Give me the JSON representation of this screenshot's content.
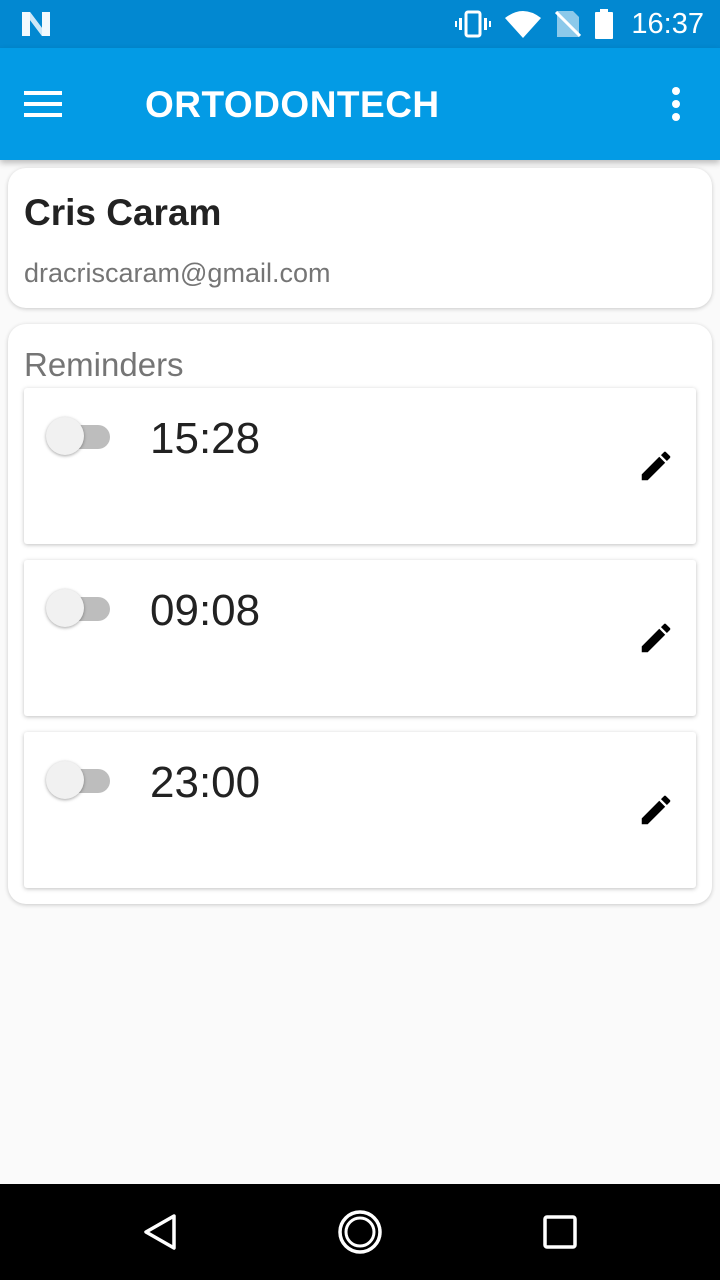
{
  "status_bar": {
    "time": "16:37",
    "icons": [
      "n-logo-icon",
      "vibrate-icon",
      "wifi-icon",
      "no-sim-icon",
      "battery-icon"
    ]
  },
  "app_bar": {
    "title": "ORTODONTECH",
    "menu_icon": "hamburger-menu-icon",
    "overflow_icon": "more-vert-icon"
  },
  "profile": {
    "name": "Cris Caram",
    "email": "dracriscaram@gmail.com"
  },
  "reminders": {
    "title": "Reminders",
    "items": [
      {
        "time": "15:28",
        "enabled": false,
        "edit_icon": "pencil-icon"
      },
      {
        "time": "09:08",
        "enabled": false,
        "edit_icon": "pencil-icon"
      },
      {
        "time": "23:00",
        "enabled": false,
        "edit_icon": "pencil-icon"
      }
    ]
  },
  "nav_bar": {
    "buttons": [
      "back-icon",
      "home-icon",
      "recents-icon"
    ]
  },
  "colors": {
    "status_bar": "#0288d1",
    "app_bar": "#039be5",
    "background": "#fafafa",
    "toggle_track_off": "#bdbdbd",
    "toggle_thumb_off": "#f1f1f1"
  }
}
